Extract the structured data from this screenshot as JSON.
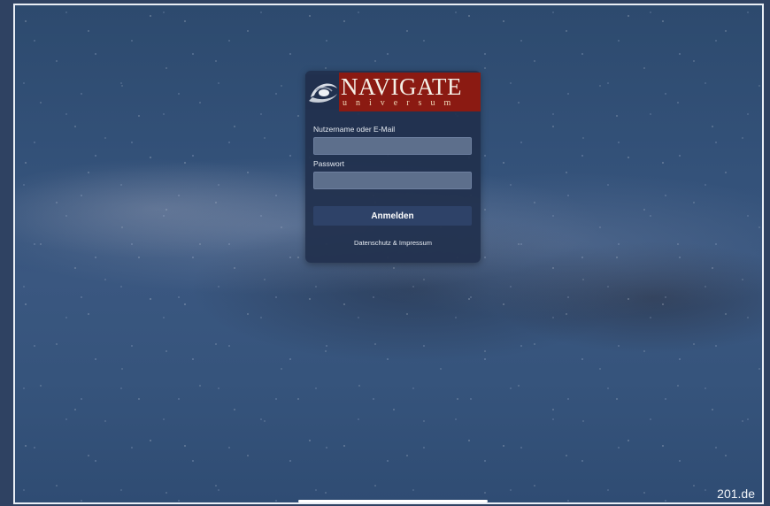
{
  "logo": {
    "word": "NAVIGATE",
    "subword": "universum",
    "emblem_icon": "galaxy-icon",
    "banner_color": "#8b1a12"
  },
  "login": {
    "username_label": "Nutzername oder E-Mail",
    "username_value": "",
    "password_label": "Passwort",
    "password_value": "",
    "submit_label": "Anmelden",
    "footer_link": "Datenschutz & Impressum"
  },
  "watermark": "201.de",
  "colors": {
    "card_background": "#21304e",
    "input_background": "#5d6f8c",
    "button_background": "#2e4268"
  }
}
